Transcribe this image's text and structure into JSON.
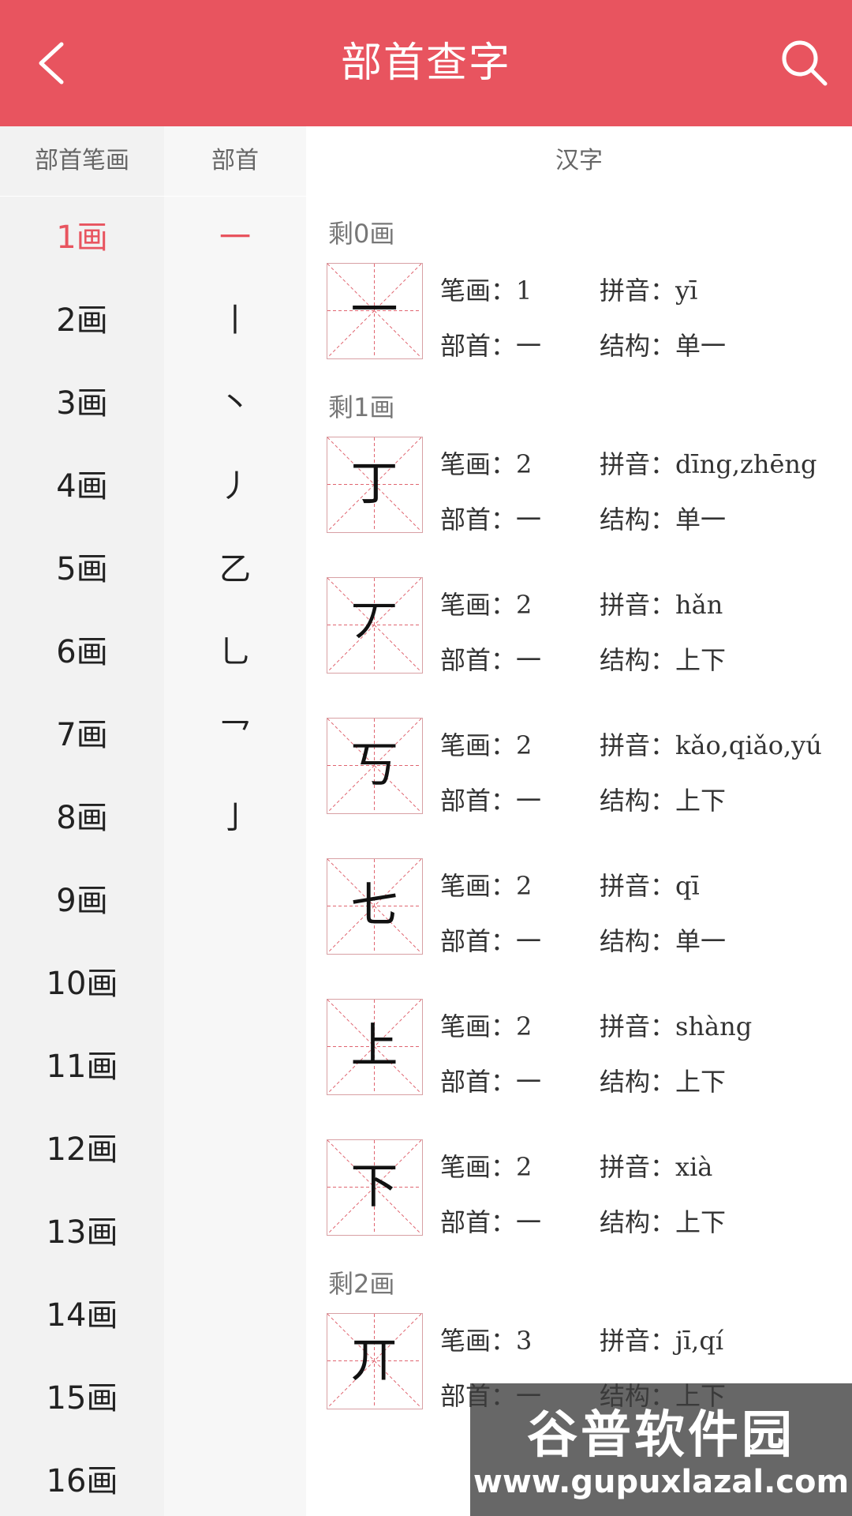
{
  "header": {
    "title": "部首查字"
  },
  "columns": {
    "strokes": "部首笔画",
    "radical": "部首",
    "chars": "汉字"
  },
  "stroke_counts": [
    "1画",
    "2画",
    "3画",
    "4画",
    "5画",
    "6画",
    "7画",
    "8画",
    "9画",
    "10画",
    "11画",
    "12画",
    "13画",
    "14画",
    "15画",
    "16画"
  ],
  "radicals": [
    "一",
    "丨",
    "丶",
    "丿",
    "乙",
    "乚",
    "乛",
    "亅"
  ],
  "labels": {
    "strokes": "笔画：",
    "pinyin": "拼音：",
    "radical": "部首：",
    "structure": "结构："
  },
  "sections": [
    {
      "title": "剩0画",
      "entries": [
        {
          "char": "一",
          "strokes": "1",
          "pinyin": "yī",
          "radical": "一",
          "structure": "单一"
        }
      ]
    },
    {
      "title": "剩1画",
      "entries": [
        {
          "char": "丁",
          "strokes": "2",
          "pinyin": "dīng,zhēng",
          "radical": "一",
          "structure": "单一"
        },
        {
          "char": "丆",
          "strokes": "2",
          "pinyin": "hǎn",
          "radical": "一",
          "structure": "上下"
        },
        {
          "char": "丂",
          "strokes": "2",
          "pinyin": "kǎo,qiǎo,yú",
          "radical": "一",
          "structure": "上下"
        },
        {
          "char": "七",
          "strokes": "2",
          "pinyin": "qī",
          "radical": "一",
          "structure": "单一"
        },
        {
          "char": "上",
          "strokes": "2",
          "pinyin": "shàng",
          "radical": "一",
          "structure": "上下"
        },
        {
          "char": "下",
          "strokes": "2",
          "pinyin": "xià",
          "radical": "一",
          "structure": "上下"
        }
      ]
    },
    {
      "title": "剩2画",
      "entries": [
        {
          "char": "丌",
          "strokes": "3",
          "pinyin": "jī,qí",
          "radical": "一",
          "structure": "上下"
        }
      ]
    }
  ],
  "watermark": {
    "brand": "谷普软件园",
    "url": "www.gupuxlazal.com"
  },
  "colors": {
    "accent": "#e8545f",
    "gridline": "#e06570"
  }
}
